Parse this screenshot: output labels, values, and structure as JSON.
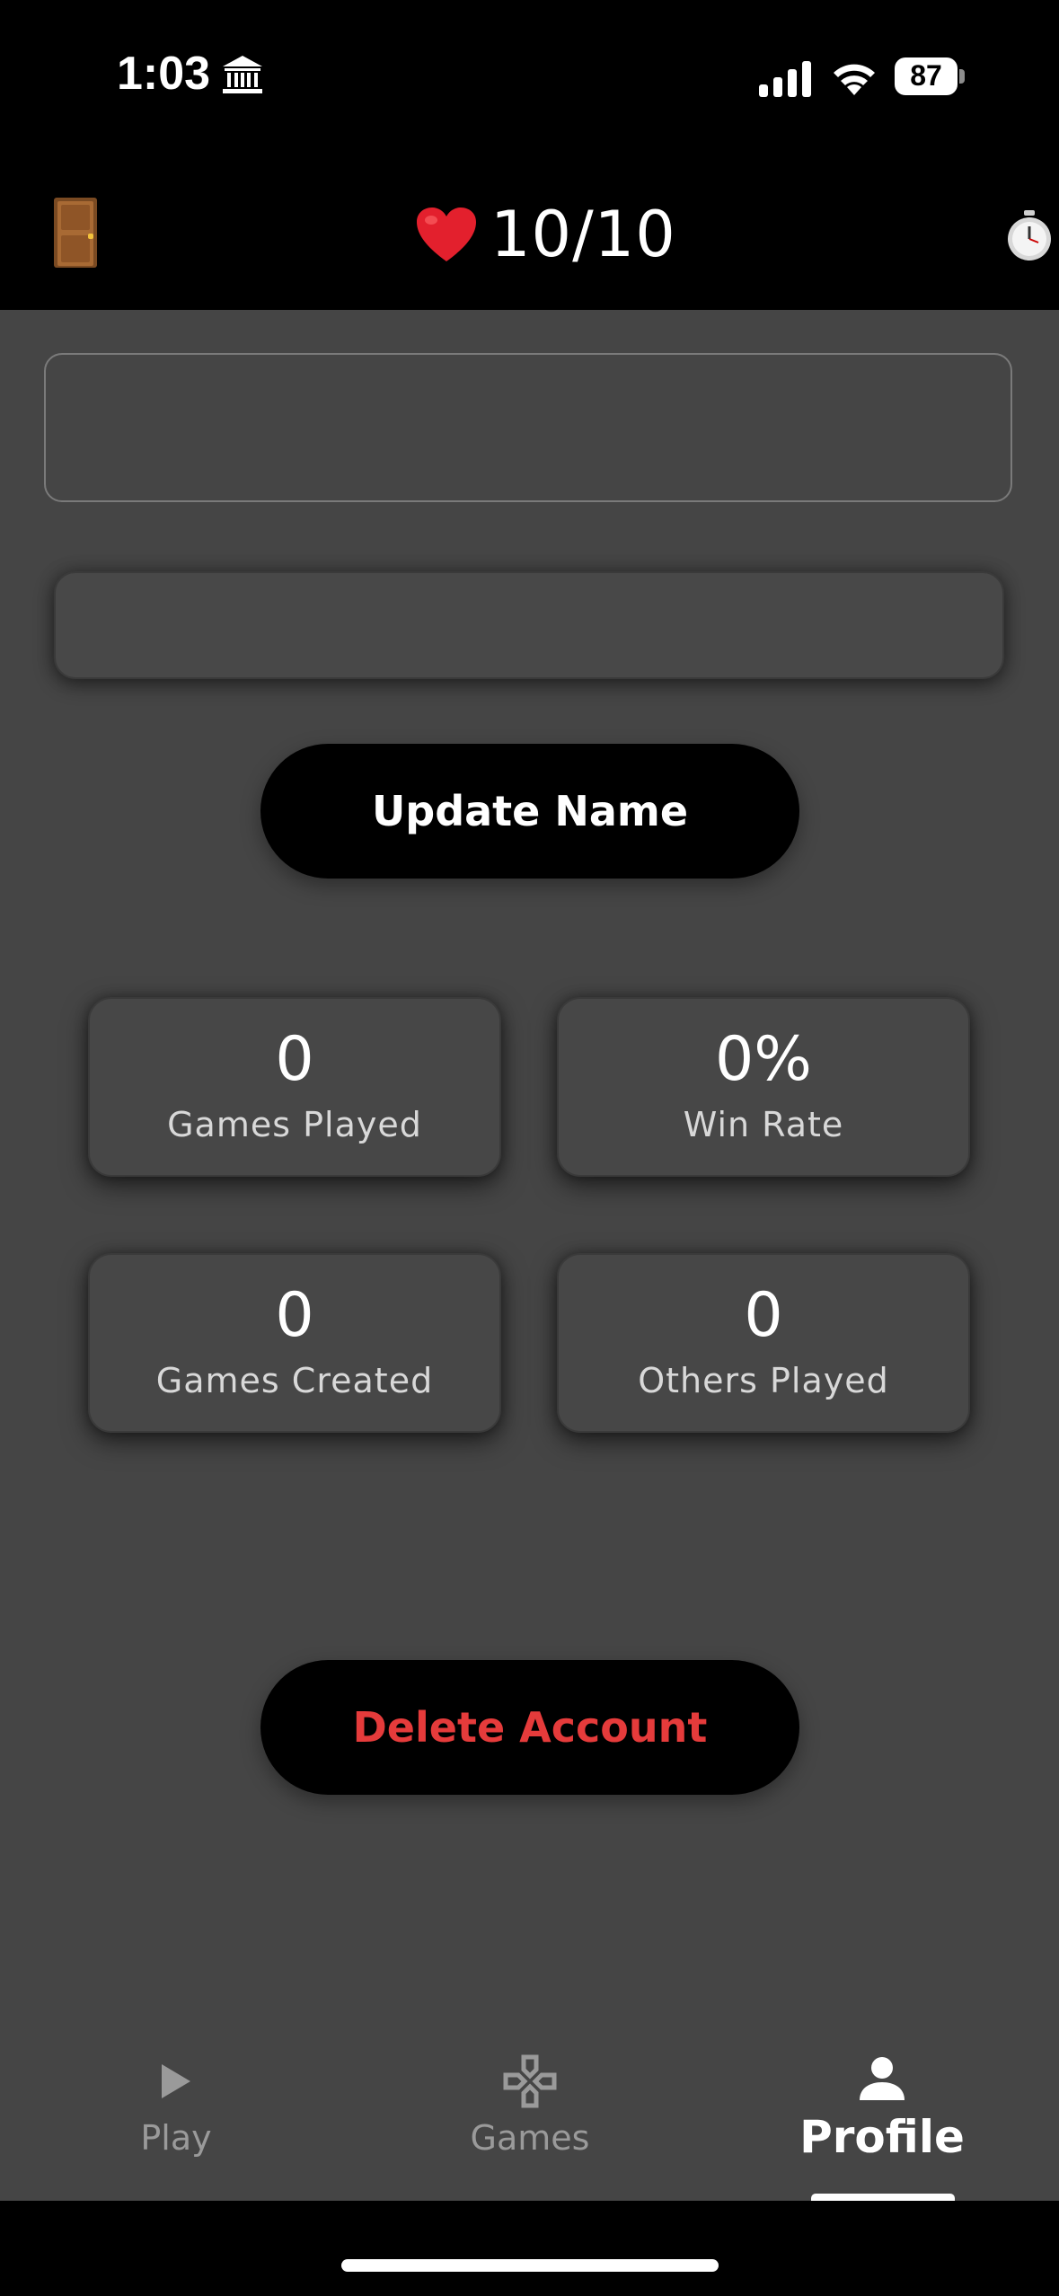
{
  "status_bar": {
    "time": "1:03",
    "battery": "87"
  },
  "header": {
    "lives": "10/10",
    "icons": [
      "door-icon",
      "heart-icon",
      "stopwatch-icon"
    ]
  },
  "profile": {
    "display_name": "",
    "name_input_value": "",
    "update_label": "Update Name",
    "delete_label": "Delete Account"
  },
  "stats": [
    {
      "value": "0",
      "label": "Games Played"
    },
    {
      "value": "0%",
      "label": "Win Rate"
    },
    {
      "value": "0",
      "label": "Games Created"
    },
    {
      "value": "0",
      "label": "Others Played"
    }
  ],
  "nav": {
    "tabs": [
      {
        "label": "Play",
        "icon": "play-icon"
      },
      {
        "label": "Games",
        "icon": "gamepad-icon"
      },
      {
        "label": "Profile",
        "icon": "person-icon"
      }
    ],
    "active": "Profile"
  },
  "colors": {
    "background": "#454545",
    "header": "#000000",
    "danger": "#e53b3b",
    "heart": "#e3202d"
  }
}
